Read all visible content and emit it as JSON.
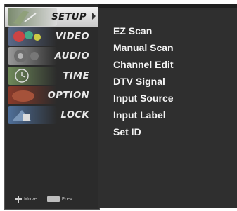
{
  "menu": {
    "items": [
      {
        "label": "SETUP",
        "icon": "setup-icon",
        "active": true
      },
      {
        "label": "VIDEO",
        "icon": "video-icon",
        "active": false
      },
      {
        "label": "AUDIO",
        "icon": "audio-icon",
        "active": false
      },
      {
        "label": "TIME",
        "icon": "time-icon",
        "active": false
      },
      {
        "label": "OPTION",
        "icon": "option-icon",
        "active": false
      },
      {
        "label": "LOCK",
        "icon": "lock-icon",
        "active": false
      }
    ]
  },
  "footer": {
    "move_label": "Move",
    "prev_label": "Prev"
  },
  "submenu": {
    "items": [
      "EZ Scan",
      "Manual Scan",
      "Channel Edit",
      "DTV Signal",
      "Input Source",
      "Input Label",
      "Set ID"
    ]
  },
  "colors": {
    "menu_bg": "#2b2b2b",
    "panel_bg": "#2f2f2f",
    "active_bg": "#e6e6e6",
    "text": "#f4f4f4"
  }
}
